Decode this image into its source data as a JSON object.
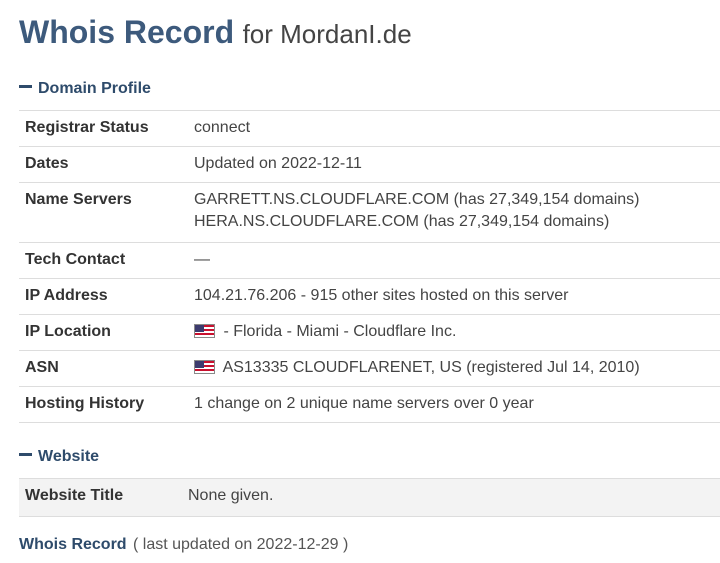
{
  "title": {
    "main": "Whois Record",
    "sub": "for MordanI.de"
  },
  "domain_profile": {
    "heading": "Domain Profile",
    "rows": [
      {
        "label": "Registrar Status",
        "value": "connect"
      },
      {
        "label": "Dates",
        "value": "Updated on 2022-12-11"
      },
      {
        "label": "Name Servers",
        "value": "GARRETT.NS.CLOUDFLARE.COM (has 27,349,154 domains)",
        "value2": "HERA.NS.CLOUDFLARE.COM (has 27,349,154 domains)"
      },
      {
        "label": "Tech Contact",
        "value": "—"
      },
      {
        "label": "IP Address",
        "value": "104.21.76.206 - 915 other sites hosted on this server"
      },
      {
        "label": "IP Location",
        "value": " - Florida - Miami - Cloudflare Inc.",
        "icon": "us-flag-icon"
      },
      {
        "label": "ASN",
        "value": " AS13335 CLOUDFLARENET, US (registered Jul 14, 2010)",
        "icon": "us-flag-icon"
      },
      {
        "label": "Hosting History",
        "value": "1 change on 2 unique name servers over 0 year"
      }
    ]
  },
  "website": {
    "heading": "Website",
    "rows": [
      {
        "label": "Website Title",
        "value": "None given."
      }
    ]
  },
  "footer": {
    "link": "Whois Record",
    "updated": "( last updated on 2022-12-29 )"
  }
}
